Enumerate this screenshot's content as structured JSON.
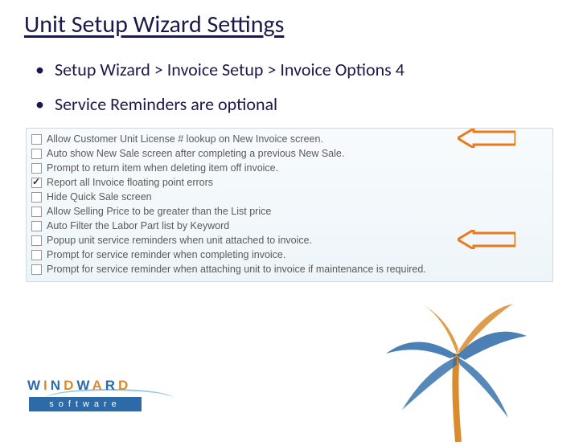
{
  "title": "Unit Setup Wizard Settings",
  "bullets": [
    "Setup Wizard > Invoice Setup > Invoice Options 4",
    "Service Reminders are optional"
  ],
  "options": [
    {
      "label": "Allow Customer Unit License # lookup on New Invoice screen.",
      "checked": false,
      "highlight": true
    },
    {
      "label": "Auto show New Sale screen after completing a previous New Sale.",
      "checked": false,
      "highlight": false
    },
    {
      "label": "Prompt to return item when deleting item off invoice.",
      "checked": false,
      "highlight": false
    },
    {
      "label": "Report all Invoice floating point errors",
      "checked": true,
      "highlight": false
    },
    {
      "label": "Hide Quick Sale screen",
      "checked": false,
      "highlight": false
    },
    {
      "label": "Allow Selling Price to be greater than the List price",
      "checked": false,
      "highlight": false
    },
    {
      "label": "Auto Filter the Labor Part list by Keyword",
      "checked": false,
      "highlight": false
    },
    {
      "label": "Popup unit service reminders when unit attached to invoice.",
      "checked": false,
      "highlight": true
    },
    {
      "label": "Prompt for service reminder when completing invoice.",
      "checked": false,
      "highlight": false
    },
    {
      "label": "Prompt for service reminder when attaching unit to invoice if maintenance is required.",
      "checked": false,
      "highlight": false
    }
  ],
  "brand": {
    "name": "WINDWARD",
    "sub": "software"
  }
}
